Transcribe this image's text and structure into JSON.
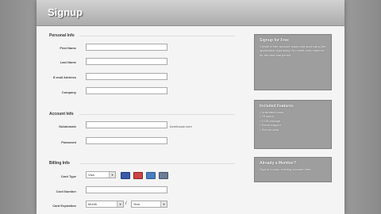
{
  "header": {
    "title": "Signup"
  },
  "personal": {
    "title": "Personal Info",
    "fields": [
      {
        "label": "First Name",
        "value": ""
      },
      {
        "label": "Last Name",
        "value": ""
      },
      {
        "label": "E-mail Address",
        "value": ""
      },
      {
        "label": "Company",
        "value": ""
      }
    ]
  },
  "account": {
    "title": "Account Info",
    "subdomain": {
      "label": "Subdomain",
      "value": "",
      "suffix": ".formhouse.com"
    },
    "password": {
      "label": "Password",
      "value": ""
    }
  },
  "billing": {
    "title": "Billing Info",
    "card_type": {
      "label": "Card Type",
      "value": "Visa",
      "cards": [
        "visa-icon",
        "mastercard-icon",
        "amex-icon",
        "discover-icon"
      ]
    },
    "card_number": {
      "label": "Card Number",
      "value": ""
    },
    "expiration": {
      "label": "Card Expiration",
      "month": "Month",
      "separator": "/",
      "year": "Year"
    }
  },
  "sidebar": {
    "box1": {
      "title": "Signup for Free",
      "text": "Create a free account today and start using the application right away. No credit card required for the free trial period."
    },
    "box2": {
      "title": "Included Features",
      "items": [
        "• Unlimited forms",
        "• 25 users",
        "• 5 GB storage",
        "• Email support",
        "• Secure data"
      ]
    },
    "box3": {
      "title": "Already a Member?",
      "text": "Sign in to your existing account here."
    }
  },
  "colors": {
    "page": "#f4f4f4",
    "sidebox": "#9e9e9e",
    "background": "#8d8d8d"
  }
}
